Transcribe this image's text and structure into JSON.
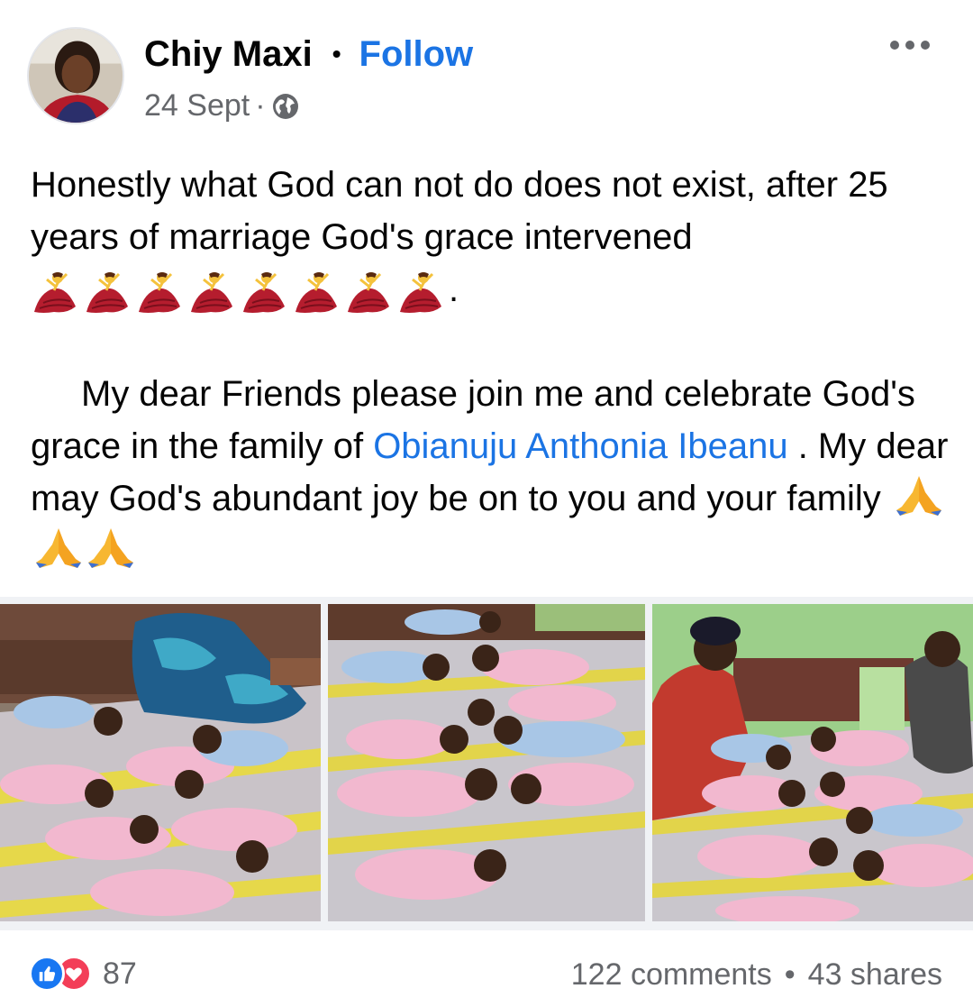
{
  "post": {
    "author": "Chiy Maxi",
    "separator": "•",
    "follow_label": "Follow",
    "date": "24 Sept",
    "meta_separator": "·",
    "privacy_icon": "globe-icon",
    "paragraph1": "Honestly what God can not do does not exist, after 25 years of marriage God's grace intervened",
    "emoji_dancer": "woman-dancing-emoji",
    "emoji_dancer_count": 8,
    "emoji_trailing": ".",
    "paragraph2_prefix": "My dear Friends please join me and celebrate God's grace in the family of ",
    "mention": "Obianuju Anthonia Ibeanu",
    "paragraph2_suffix": " . My dear may God's abundant joy be on to you and your family ",
    "emoji_pray": "folded-hands-emoji",
    "emoji_pray_count": 3
  },
  "photos": [
    {
      "name": "photo-babies-woman-lying"
    },
    {
      "name": "photo-babies-on-bed"
    },
    {
      "name": "photo-babies-two-women"
    }
  ],
  "footer": {
    "reaction_icons": [
      "like-icon",
      "love-icon"
    ],
    "reaction_count": "87",
    "comments": "122 comments",
    "stats_separator": "•",
    "shares": "43 shares"
  },
  "colors": {
    "link": "#1b74e4",
    "secondary_text": "#65676b",
    "like": "#1877f2",
    "love": "#f33e58"
  }
}
